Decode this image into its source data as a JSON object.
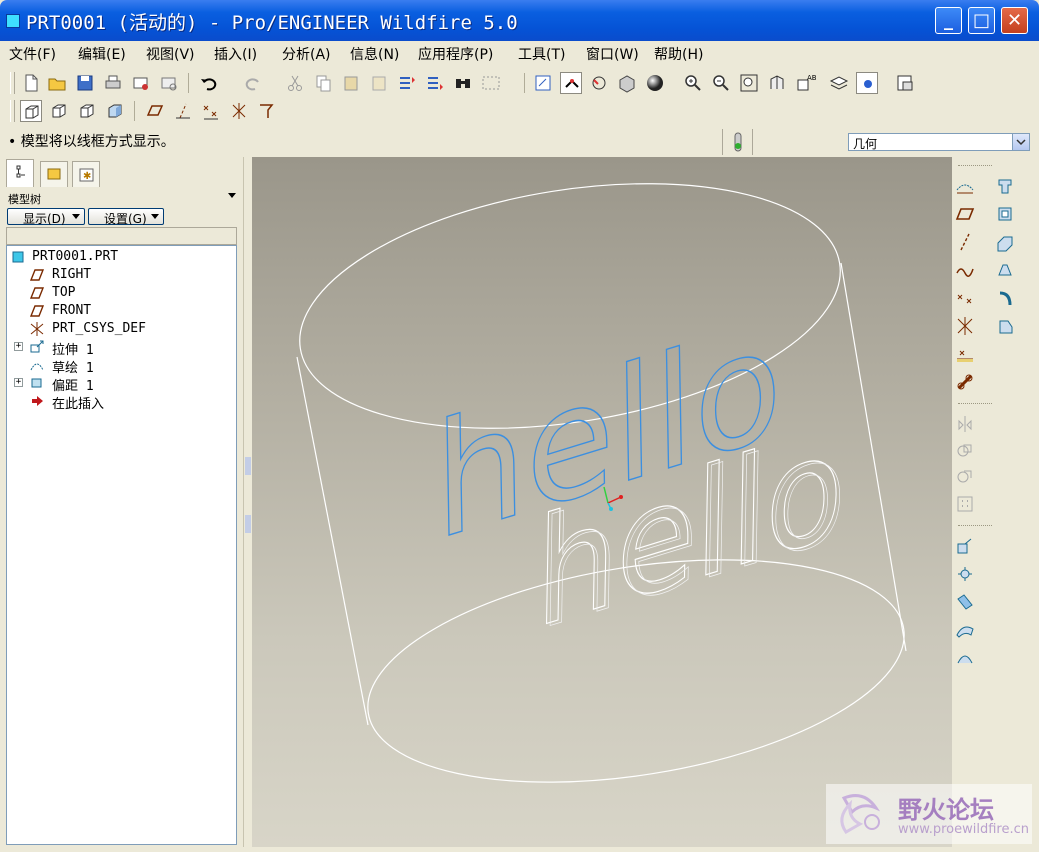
{
  "window": {
    "title": "PRT0001 (活动的) - Pro/ENGINEER Wildfire 5.0",
    "minimize_label": "_",
    "maximize_label": "□",
    "close_label": "✕"
  },
  "menu": {
    "items": [
      {
        "label": "文件(F)"
      },
      {
        "label": "编辑(E)"
      },
      {
        "label": "视图(V)"
      },
      {
        "label": "插入(I)"
      },
      {
        "label": "分析(A)"
      },
      {
        "label": "信息(N)"
      },
      {
        "label": "应用程序(P)"
      },
      {
        "label": "工具(T)"
      },
      {
        "label": "窗口(W)"
      },
      {
        "label": "帮助(H)"
      }
    ]
  },
  "status": {
    "message": "• 模型将以线框方式显示。",
    "filter_value": "几何"
  },
  "model_tree": {
    "label": "模型树",
    "show_button": "显示(D)",
    "settings_button": "设置(G)",
    "items": [
      {
        "label": "PRT0001.PRT",
        "icon": "part-icon"
      },
      {
        "label": "RIGHT",
        "icon": "datum-plane-icon"
      },
      {
        "label": "TOP",
        "icon": "datum-plane-icon"
      },
      {
        "label": "FRONT",
        "icon": "datum-plane-icon"
      },
      {
        "label": "PRT_CSYS_DEF",
        "icon": "csys-icon"
      },
      {
        "label": "拉伸 1",
        "icon": "extrude-icon"
      },
      {
        "label": "草绘 1",
        "icon": "sketch-icon"
      },
      {
        "label": "偏距 1",
        "icon": "offset-icon"
      },
      {
        "label": "在此插入",
        "icon": "insert-here-arrow-icon"
      }
    ]
  },
  "viewport": {
    "sketch_text": "hello",
    "projected_text": "hello",
    "sketch_color": "#3c8fe0",
    "wire_color": "#ffffff"
  },
  "watermark": {
    "title": "野火论坛",
    "url": "www.proewildfire.cn"
  },
  "colors": {
    "titlebar": "#0553d6",
    "menu_bg": "#ece9d8",
    "accent": "#316ac5"
  }
}
